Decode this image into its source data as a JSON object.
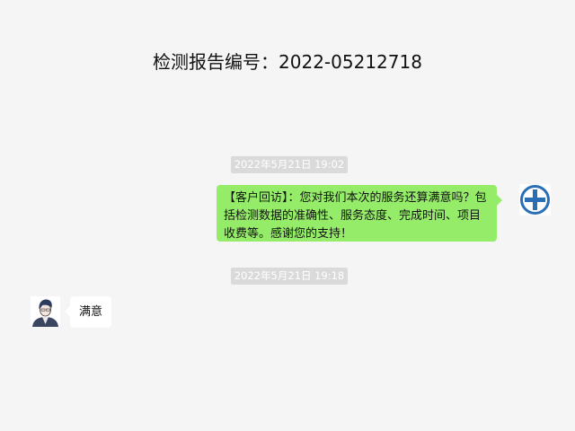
{
  "header": {
    "report_title": "检测报告编号：2022-05212718"
  },
  "messages": [
    {
      "timestamp": "2022年5月21日 19:02",
      "direction": "outgoing",
      "text": "【客户回访】：您对我们本次的服务还算满意吗？包括检测数据的准确性、服务态度、完成时间、项目收费等。感谢您的支持！",
      "avatar": "hospital-logo-icon"
    },
    {
      "timestamp": "2022年5月21日 19:18",
      "direction": "incoming",
      "text": "满意",
      "avatar": "user-avatar-icon"
    }
  ],
  "colors": {
    "background": "#f5f5f5",
    "outgoing_bubble": "#95ec69",
    "incoming_bubble": "#ffffff",
    "timestamp_bg": "#dadada",
    "logo_blue": "#2a6fb5"
  }
}
